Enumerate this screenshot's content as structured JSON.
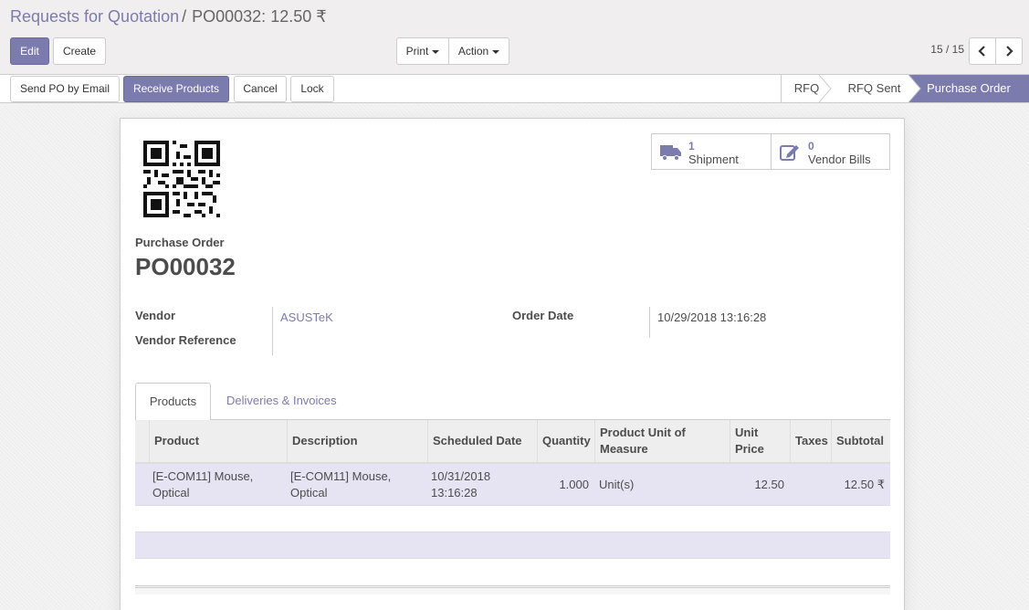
{
  "breadcrumb": {
    "parent": "Requests for Quotation",
    "separator": "/",
    "current": "PO00032: 12.50 ₹"
  },
  "toolbar": {
    "edit_label": "Edit",
    "create_label": "Create",
    "print_label": "Print",
    "action_label": "Action",
    "pager_value": "15 / 15"
  },
  "statusbar": {
    "buttons": {
      "send_po": "Send PO by Email",
      "receive_products": "Receive Products",
      "cancel": "Cancel",
      "lock": "Lock"
    },
    "stages": [
      "RFQ",
      "RFQ Sent",
      "Purchase Order"
    ],
    "active_stage": "Purchase Order"
  },
  "smart_buttons": {
    "shipment": {
      "count": "1",
      "label": "Shipment",
      "icon": "truck-icon"
    },
    "vendor_bills": {
      "count": "0",
      "label": "Vendor Bills",
      "icon": "edit-icon"
    }
  },
  "form": {
    "doc_type_label": "Purchase Order",
    "doc_name": "PO00032",
    "vendor_label": "Vendor",
    "vendor_value": "ASUSTeK",
    "vendor_ref_label": "Vendor Reference",
    "vendor_ref_value": "",
    "order_date_label": "Order Date",
    "order_date_value": "10/29/2018 13:16:28"
  },
  "tabs": {
    "products": "Products",
    "deliveries": "Deliveries & Invoices"
  },
  "lines_table": {
    "headers": {
      "product": "Product",
      "description": "Description",
      "scheduled_date": "Scheduled Date",
      "quantity": "Quantity",
      "uom": "Product Unit of Measure",
      "unit_price": "Unit Price",
      "taxes": "Taxes",
      "subtotal": "Subtotal"
    },
    "rows": [
      {
        "product": "[E-COM11] Mouse, Optical",
        "description": "[E-COM11] Mouse, Optical",
        "scheduled_date": "10/31/2018 13:16:28",
        "quantity": "1.000",
        "uom": "Unit(s)",
        "unit_price": "12.50",
        "taxes": "",
        "subtotal": "12.50 ₹"
      }
    ]
  },
  "colors": {
    "accent": "#7c7bad",
    "row_highlight": "#e6e4f2",
    "text": "#4c4c4c"
  }
}
